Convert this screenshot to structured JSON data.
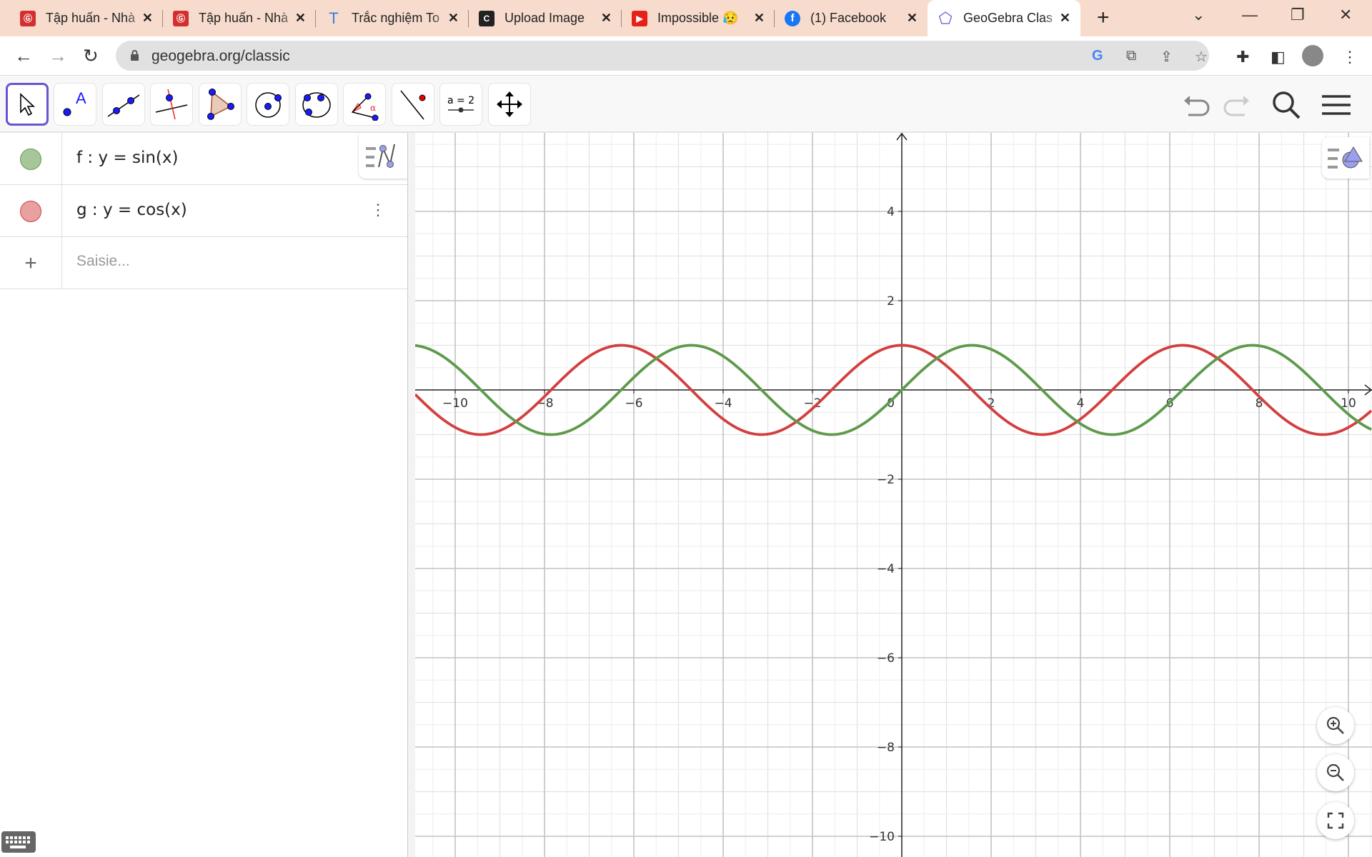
{
  "browser": {
    "tabs": [
      {
        "title": "Tập huấn - Nhà",
        "favicon": "gd-logo-icon",
        "color": "#d32f2f"
      },
      {
        "title": "Tập huấn - Nhà",
        "favicon": "gd-logo-icon",
        "color": "#d32f2f"
      },
      {
        "title": "Trắc nghiệm To",
        "favicon": "t-letter-icon",
        "color": "#3b7ddd"
      },
      {
        "title": "Upload Image",
        "favicon": "c-letter-icon",
        "color": "#222"
      },
      {
        "title": "Impossible 😥",
        "favicon": "youtube-icon",
        "color": "#e62117"
      },
      {
        "title": "(1) Facebook",
        "favicon": "facebook-icon",
        "color": "#1877f2"
      },
      {
        "title": "GeoGebra Clas",
        "favicon": "geogebra-icon",
        "color": "#6557d2",
        "active": true
      }
    ],
    "new_tab": "+",
    "url": "geogebra.org/classic"
  },
  "toolbar": {
    "tools": [
      "move-tool",
      "point-tool",
      "line-tool",
      "perpendicular-tool",
      "polygon-tool",
      "circle-center-tool",
      "circle-three-points-tool",
      "angle-tool",
      "reflect-tool",
      "slider-tool",
      "move-view-tool"
    ],
    "slider_label": "a = 2"
  },
  "algebra": {
    "items": [
      {
        "expr": "f :  y = sin(x)",
        "color": "#5e9a4b",
        "fill": "#a7c79b"
      },
      {
        "expr": "g :  y = cos(x)",
        "color": "#d33f3f",
        "fill": "#e8a0a0"
      }
    ],
    "input_placeholder": "Saisie..."
  },
  "chart_data": {
    "type": "line",
    "title": "",
    "xlabel": "",
    "ylabel": "",
    "xlim": [
      -10.9,
      10.7
    ],
    "ylim": [
      -10.5,
      5.8
    ],
    "grid": true,
    "x_ticks": [
      -10,
      -8,
      -6,
      -4,
      -2,
      0,
      2,
      4,
      6,
      8,
      10
    ],
    "y_ticks": [
      4,
      2,
      -2,
      -4,
      -6,
      -8,
      -10
    ],
    "series": [
      {
        "name": "f",
        "expr": "sin(x)",
        "color": "#5e9a4b"
      },
      {
        "name": "g",
        "expr": "cos(x)",
        "color": "#d33f3f"
      }
    ]
  }
}
